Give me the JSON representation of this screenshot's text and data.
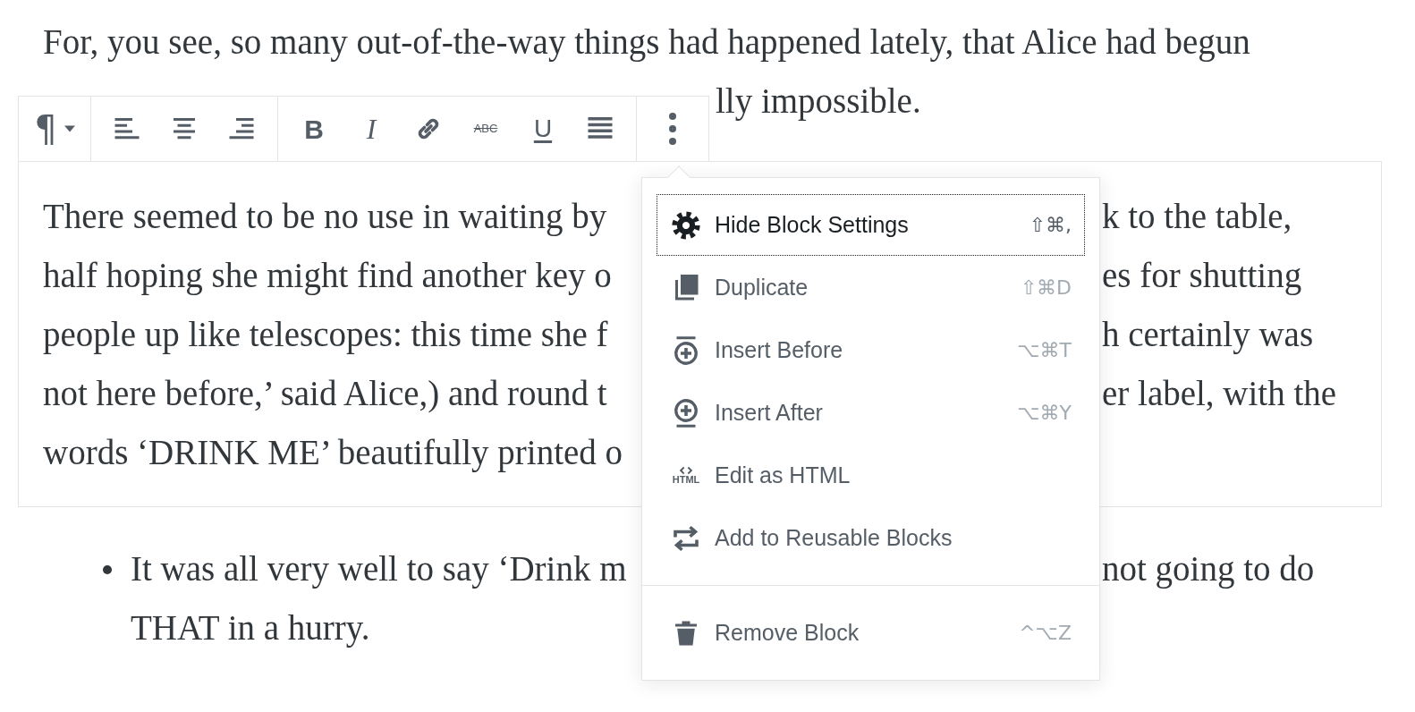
{
  "page": {
    "lines_above": [
      {
        "left": "For, you see, so many out-of-the-way things had happened lately, that Alice had begun"
      },
      {
        "right": "lly impossible."
      }
    ],
    "block": [
      {
        "left": "There seemed to be no use in waiting by",
        "right": "k to the table,"
      },
      {
        "left": "half hoping she might find another key o",
        "right": "es for shutting"
      },
      {
        "left": "people up like telescopes: this time she f",
        "right": "h certainly was"
      },
      {
        "left": "not here before,’ said Alice,) and round t",
        "right": "er label, with the"
      },
      {
        "left": "words ‘DRINK ME’ beautifully printed o"
      }
    ],
    "bullet_list": [
      {
        "lines": [
          {
            "left": "It was all very well to say ‘Drink m",
            "right": "not going to do"
          },
          {
            "left": "THAT in a hurry."
          }
        ]
      }
    ]
  },
  "toolbar": {
    "groups": [
      [
        {
          "kind": "paragraph",
          "label": "¶",
          "dropdown": true
        }
      ],
      [
        {
          "kind": "align_left"
        },
        {
          "kind": "align_center"
        },
        {
          "kind": "align_right"
        }
      ],
      [
        {
          "kind": "bold",
          "label": "B"
        },
        {
          "kind": "italic",
          "label": "I"
        },
        {
          "kind": "link"
        },
        {
          "kind": "strike",
          "label": "ABC"
        },
        {
          "kind": "underline",
          "label": "U"
        },
        {
          "kind": "justify"
        }
      ],
      [
        {
          "kind": "more"
        }
      ]
    ]
  },
  "menu": {
    "groups": [
      [
        {
          "kind": "gear",
          "label": "Hide Block Settings",
          "shortcut": "⇧⌘,",
          "focused": true
        },
        {
          "kind": "duplicate",
          "label": "Duplicate",
          "shortcut": "⇧⌘D",
          "focused": false
        },
        {
          "kind": "insert_before",
          "label": "Insert Before",
          "shortcut": "⌥⌘T",
          "focused": false
        },
        {
          "kind": "insert_after",
          "label": "Insert After",
          "shortcut": "⌥⌘Y",
          "focused": false
        },
        {
          "kind": "html",
          "icon_label": "HTML",
          "label": "Edit as HTML",
          "focused": false
        },
        {
          "kind": "reusable",
          "label": "Add to Reusable Blocks",
          "focused": false
        }
      ],
      [
        {
          "kind": "trash",
          "label": "Remove Block",
          "shortcut": "^⌥Z",
          "focused": false
        }
      ]
    ]
  }
}
